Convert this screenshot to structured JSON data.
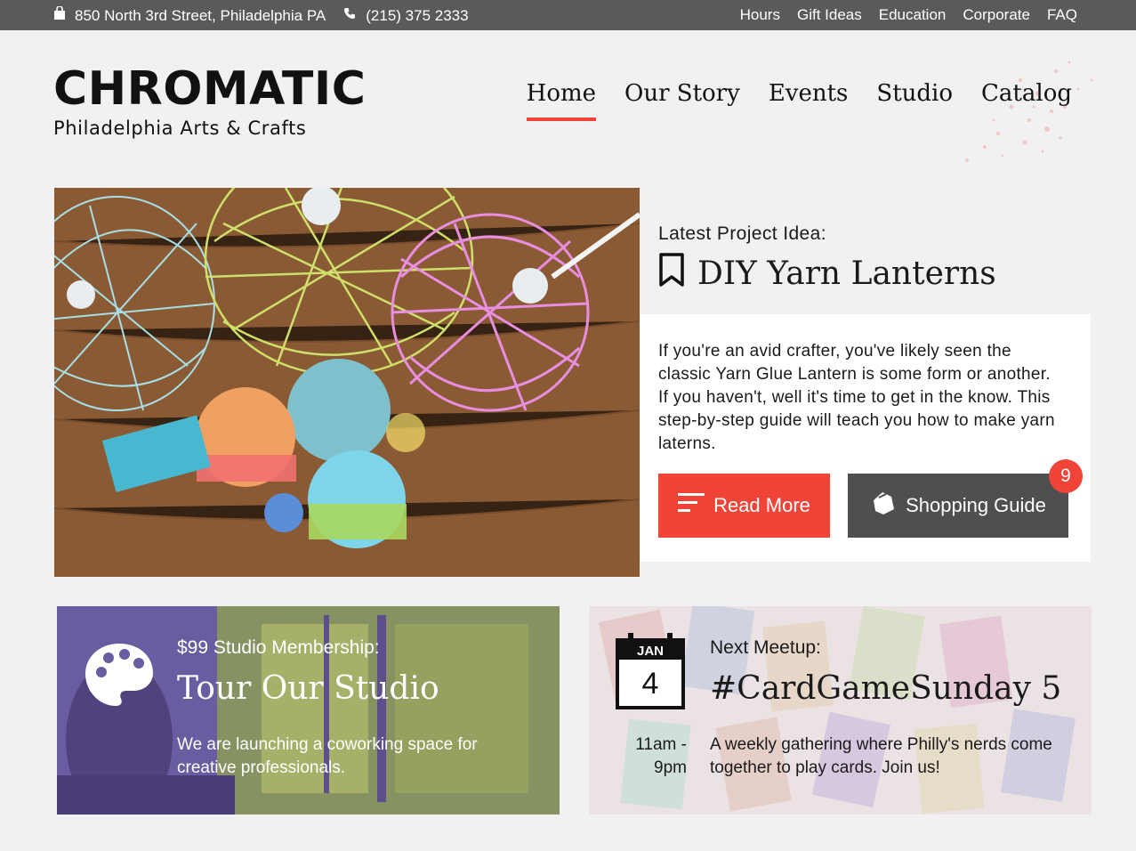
{
  "topbar": {
    "address": "850 North 3rd Street, Philadelphia PA",
    "phone": "(215) 375 2333",
    "links": [
      "Hours",
      "Gift Ideas",
      "Education",
      "Corporate",
      "FAQ"
    ]
  },
  "brand": {
    "name": "CHROMATIC",
    "tagline": "Philadelphia Arts & Crafts",
    "accent": "#ef4437"
  },
  "nav": {
    "items": [
      "Home",
      "Our Story",
      "Events",
      "Studio",
      "Catalog"
    ],
    "active": "Home"
  },
  "hero": {
    "kicker": "Latest Project Idea:",
    "title": "DIY Yarn Lanterns",
    "description": "If you're an avid crafter, you've likely seen the classic Yarn Glue Lantern is some form or another. If you haven't, well it's time to get in the know. This step-by-step guide will teach you how to make yarn laterns.",
    "read_more": "Read More",
    "shopping_guide": "Shopping Guide",
    "badge_count": "9"
  },
  "studio": {
    "kicker": "$99 Studio Membership:",
    "title": "Tour Our Studio",
    "description": "We are launching a coworking space for creative professionals."
  },
  "meetup": {
    "kicker": "Next Meetup:",
    "title": "#CardGameSunday 5",
    "description": "A weekly gathering where Philly's nerds come together to play cards. Join us!",
    "time_start": "11am -",
    "time_end": "9pm",
    "month": "JAN",
    "day": "4"
  }
}
